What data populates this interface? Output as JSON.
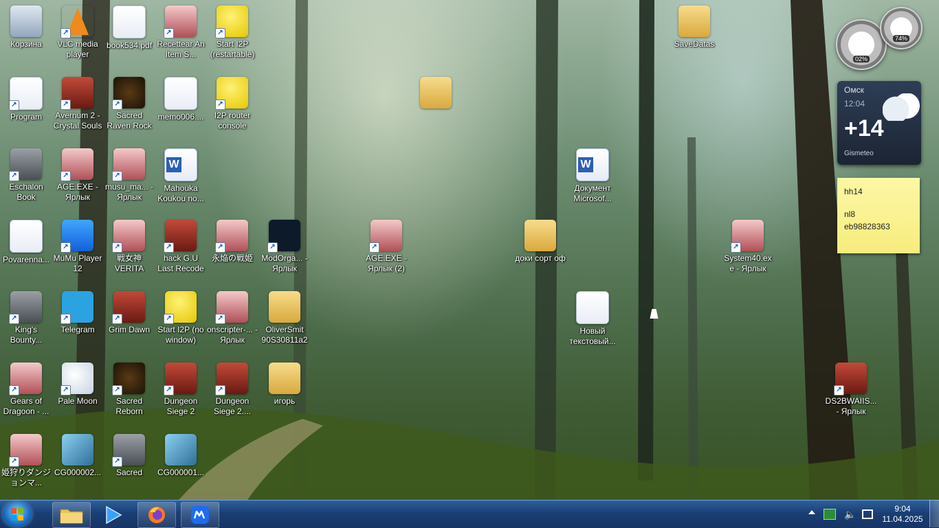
{
  "desktop_icons": [
    {
      "label": "Корзина",
      "icon": "recycle-bin-icon",
      "style": "recycle",
      "shortcut": false
    },
    {
      "label": "VLC media player",
      "icon": "vlc-icon",
      "style": "vlc",
      "shortcut": true
    },
    {
      "label": "book534.pdf",
      "icon": "pdf-icon",
      "style": "doc",
      "shortcut": false
    },
    {
      "label": "Recettear An Item S...",
      "icon": "recettear-icon",
      "style": "anime",
      "shortcut": true
    },
    {
      "label": "Start I2P (restartable)",
      "icon": "i2p-icon",
      "style": "yellow",
      "shortcut": true
    },
    {
      "label": "Program",
      "icon": "program-icon",
      "style": "doc",
      "shortcut": true
    },
    {
      "label": "Avernum 2 - Crystal Souls",
      "icon": "avernum-icon",
      "style": "red",
      "shortcut": true
    },
    {
      "label": "Sacred Raven Rock",
      "icon": "sacred-icon",
      "style": "dark",
      "shortcut": true
    },
    {
      "label": "memo006....",
      "icon": "memo-icon",
      "style": "doc",
      "shortcut": false
    },
    {
      "label": "I2P router console",
      "icon": "i2p-console-icon",
      "style": "yellow",
      "shortcut": true
    },
    {
      "label": "Eschalon Book",
      "icon": "eschalon-icon",
      "style": "grey",
      "shortcut": true
    },
    {
      "label": "AGE.EXE - Ярлык",
      "icon": "age-icon",
      "style": "anime",
      "shortcut": true
    },
    {
      "label": "musu_ma... - Ярлык",
      "icon": "musu-icon",
      "style": "anime",
      "shortcut": true
    },
    {
      "label": "Mahouka Koukou no...",
      "icon": "word-doc-icon",
      "style": "word",
      "shortcut": false
    },
    {
      "label": "Povarenna...",
      "icon": "memo-icon",
      "style": "doc",
      "shortcut": false
    },
    {
      "label": "MuMu Player 12",
      "icon": "mumu-icon",
      "style": "blue",
      "shortcut": true
    },
    {
      "label": "戦女神VERITA",
      "icon": "verita-icon",
      "style": "anime",
      "shortcut": true
    },
    {
      "label": "hack G.U Last Recode",
      "icon": "hack-icon",
      "style": "red",
      "shortcut": true
    },
    {
      "label": "永焔の戦姫",
      "icon": "eien-icon",
      "style": "anime",
      "shortcut": true
    },
    {
      "label": "ModOrga... - Ярлык",
      "icon": "modorganizer-icon",
      "style": "mod",
      "shortcut": true
    },
    {
      "label": "King's Bounty...",
      "icon": "kings-bounty-icon",
      "style": "grey",
      "shortcut": true
    },
    {
      "label": "Telegram",
      "icon": "telegram-icon",
      "style": "telegram",
      "shortcut": true
    },
    {
      "label": "Grim Dawn",
      "icon": "grim-dawn-icon",
      "style": "red",
      "shortcut": true
    },
    {
      "label": "Start I2P (no window)",
      "icon": "i2p-icon",
      "style": "yellow",
      "shortcut": true
    },
    {
      "label": "onscripter-... - Ярлык",
      "icon": "onscripter-icon",
      "style": "anime",
      "shortcut": true
    },
    {
      "label": "OliverSmit 90S30811a2",
      "icon": "folder-icon",
      "style": "folder",
      "shortcut": false
    },
    {
      "label": "Gears of Dragoon - ...",
      "icon": "gears-icon",
      "style": "anime",
      "shortcut": true
    },
    {
      "label": "Pale Moon",
      "icon": "pale-moon-icon",
      "style": "palemoon",
      "shortcut": true
    },
    {
      "label": "Sacred Reborn",
      "icon": "sacred-icon",
      "style": "dark",
      "shortcut": true
    },
    {
      "label": "Dungeon Siege 2",
      "icon": "dungeon-siege-icon",
      "style": "red",
      "shortcut": true
    },
    {
      "label": "Dungeon Siege 2....",
      "icon": "dungeon-siege-icon",
      "style": "red",
      "shortcut": true
    },
    {
      "label": "игорь",
      "icon": "folder-icon",
      "style": "folder",
      "shortcut": false
    },
    {
      "label": "姫狩りダンジョンマ...",
      "icon": "himegari-icon",
      "style": "anime",
      "shortcut": true
    },
    {
      "label": "CG000002...",
      "icon": "image-file-icon",
      "style": "cg",
      "shortcut": false
    },
    {
      "label": "Sacred",
      "icon": "sacred-icon",
      "style": "grey",
      "shortcut": true
    },
    {
      "label": "CG000001...",
      "icon": "image-file-icon",
      "style": "cg",
      "shortcut": false
    },
    {
      "label": "AGE.EXE - Ярлык (2)",
      "icon": "age-icon",
      "style": "anime",
      "shortcut": true
    },
    {
      "label": "",
      "icon": "folder-icon",
      "style": "folder",
      "shortcut": false
    },
    {
      "label": "доки сорт оф",
      "icon": "folder-icon",
      "style": "folder",
      "shortcut": false
    },
    {
      "label": "Документ Microsof...",
      "icon": "word-doc-icon",
      "style": "word",
      "shortcut": false
    },
    {
      "label": "Новый текстовый...",
      "icon": "text-file-icon",
      "style": "doc",
      "shortcut": false
    },
    {
      "label": "SaveDatas",
      "icon": "folder-icon",
      "style": "folder",
      "shortcut": false
    },
    {
      "label": "System40.exe - Ярлык",
      "icon": "system40-icon",
      "style": "anime",
      "shortcut": true
    },
    {
      "label": "DS2BWAIIS... - Ярлык",
      "icon": "dungeon-siege-icon",
      "style": "red",
      "shortcut": true
    }
  ],
  "gadgets": {
    "cpu_meter": {
      "cpu_value": "02%",
      "ram_value": "74%"
    },
    "weather": {
      "city": "Омск",
      "time": "12:04",
      "temperature": "+14",
      "brand": "Gismeteo"
    },
    "sticky_note": {
      "lines": [
        "hh14",
        "nl8",
        "eb98828363"
      ]
    }
  },
  "taskbar": {
    "pinned": [
      {
        "name": "explorer",
        "icon": "folder-icon",
        "active": true
      },
      {
        "name": "media-player",
        "icon": "play-icon",
        "active": false
      },
      {
        "name": "firefox",
        "icon": "firefox-icon",
        "active": true
      },
      {
        "name": "mumu",
        "icon": "mumu-icon",
        "active": true
      }
    ],
    "tray": {
      "icons": [
        "show-hidden-icons-icon",
        "network-icon",
        "volume-icon",
        "action-center-icon"
      ]
    },
    "clock": {
      "time": "9:04",
      "date": "11.04.2025"
    }
  },
  "colors": {
    "taskbar": "#1a3f74",
    "accent": "#2f5f9a",
    "note": "#f7ec7e"
  }
}
